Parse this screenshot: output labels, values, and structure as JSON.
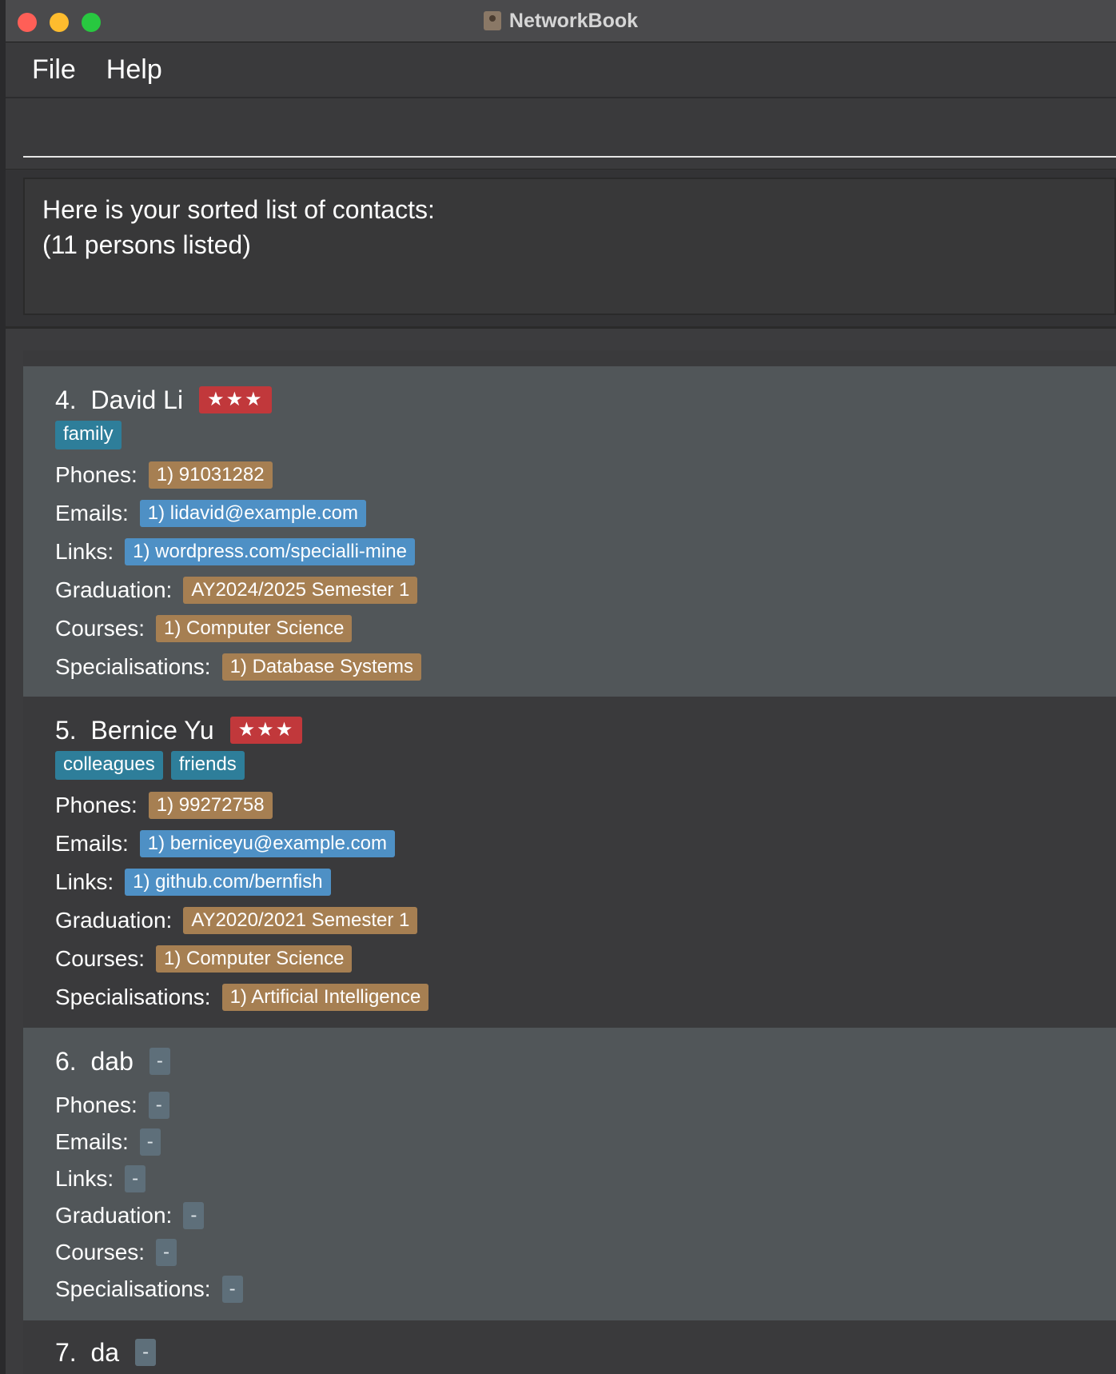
{
  "window": {
    "title": "NetworkBook"
  },
  "menu": {
    "file": "File",
    "help": "Help"
  },
  "command": {
    "value": "",
    "placeholder": ""
  },
  "result": {
    "line1": "Here is your sorted list of contacts:",
    "line2": "(11 persons listed)"
  },
  "contacts": [
    {
      "index": "4.",
      "name": "David Li",
      "priority": "★★★",
      "tags": [
        "family"
      ],
      "labels": {
        "phones": "Phones:",
        "emails": "Emails:",
        "links": "Links:",
        "graduation": "Graduation:",
        "courses": "Courses:",
        "specialisations": "Specialisations:"
      },
      "phones": "1) 91031282",
      "emails": "1) lidavid@example.com",
      "links": "1) wordpress.com/specialli-mine",
      "graduation": "AY2024/2025 Semester 1",
      "courses": "1) Computer Science",
      "specialisations": "1) Database Systems"
    },
    {
      "index": "5.",
      "name": "Bernice Yu",
      "priority": "★★★",
      "tags": [
        "colleagues",
        "friends"
      ],
      "labels": {
        "phones": "Phones:",
        "emails": "Emails:",
        "links": "Links:",
        "graduation": "Graduation:",
        "courses": "Courses:",
        "specialisations": "Specialisations:"
      },
      "phones": "1) 99272758",
      "emails": "1) berniceyu@example.com",
      "links": "1) github.com/bernfish",
      "graduation": "AY2020/2021 Semester 1",
      "courses": "1) Computer Science",
      "specialisations": "1) Artificial Intelligence"
    },
    {
      "index": "6.",
      "name": "dab",
      "priority": "-",
      "labels": {
        "phones": "Phones:",
        "emails": "Emails:",
        "links": "Links:",
        "graduation": "Graduation:",
        "courses": "Courses:",
        "specialisations": "Specialisations:"
      },
      "phones": "-",
      "emails": "-",
      "links": "-",
      "graduation": "-",
      "courses": "-",
      "specialisations": "-"
    },
    {
      "index": "7.",
      "name": "da",
      "priority": "-"
    }
  ],
  "colors": {
    "priority": "#c1383b",
    "tag": "#2e7e9a",
    "orange_badge": "#a67f52",
    "blue_badge": "#4e90c5",
    "empty_badge": "#5e6f7a"
  }
}
